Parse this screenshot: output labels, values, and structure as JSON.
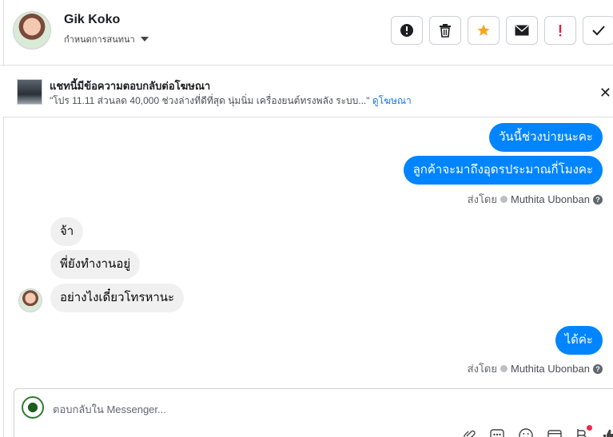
{
  "header": {
    "contact_name": "Gik Koko",
    "subtitle": "กำหนดการสนทนา",
    "actions": [
      {
        "name": "mark-spam-button",
        "icon": "exclamation-circle-icon"
      },
      {
        "name": "delete-button",
        "icon": "trash-icon"
      },
      {
        "name": "star-button",
        "icon": "star-icon",
        "color": "#f5a623"
      },
      {
        "name": "mark-unread-button",
        "icon": "envelope-icon"
      },
      {
        "name": "flag-button",
        "icon": "exclamation-icon",
        "color": "#e41e3f"
      },
      {
        "name": "mark-done-button",
        "icon": "check-icon"
      }
    ]
  },
  "ad_banner": {
    "title": "แชทนี้มีข้อความตอบกลับต่อโฆษณา",
    "body": "\"โปร 11.11 ส่วนลด 40,000 ช่วงล่างที่ดีที่สุด นุ่มนิ่ม เครื่องยนต์ทรงพลัง ระบบ...\"",
    "link": "ดูโฆษณา",
    "close": "✕"
  },
  "messages": {
    "out_1": "วันนี้ช่วงบ่ายนะคะ",
    "out_2": "ลูกค้าจะมาถึงอุดรประมาณกี่โมงคะ",
    "sent_by_label": "ส่งโดย",
    "sent_by_name": "Muthita Ubonban",
    "in_1": "จ้า",
    "in_2": "พี่ยังทำงานอยู่",
    "in_3": "อย่างไงเดี๋ยวโทรหานะ",
    "out_3": "ได้ค่ะ",
    "help_glyph": "?"
  },
  "composer": {
    "placeholder": "ตอบกลับใน Messenger..."
  },
  "colors": {
    "outgoing_bubble": "#0084ff",
    "incoming_bubble": "#f1f0f0",
    "link": "#1877f2",
    "star": "#f5a623",
    "flag": "#e41e3f"
  }
}
